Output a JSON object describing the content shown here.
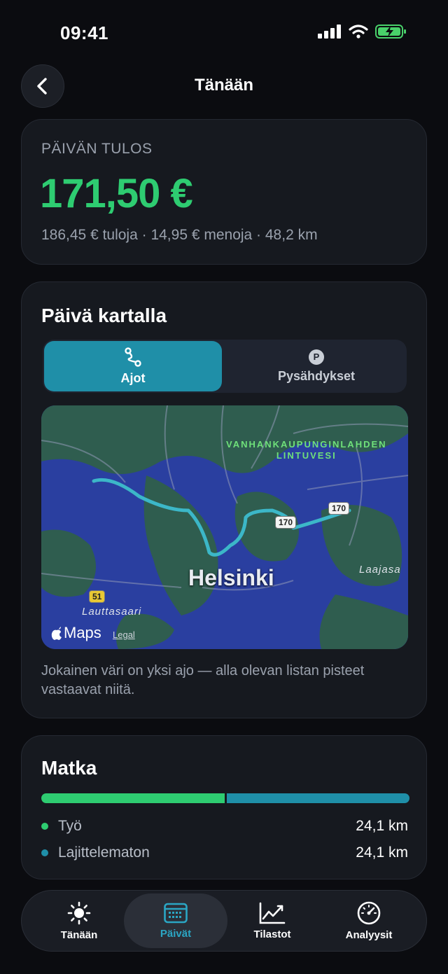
{
  "status_bar": {
    "time": "09:41"
  },
  "nav": {
    "title": "Tänään"
  },
  "summary": {
    "label": "PÄIVÄN TULOS",
    "amount": "171,50 €",
    "details": "186,45 € tuloja · 14,95 € menoja · 48,2 km"
  },
  "map_card": {
    "title": "Päivä kartalla",
    "segments": [
      {
        "label": "Ajot",
        "icon": "route-icon",
        "selected": true
      },
      {
        "label": "Pysähdykset",
        "icon": "parking-icon",
        "selected": false
      }
    ],
    "parking_badge": "P",
    "map": {
      "city_label": "Helsinki",
      "lake_label_line1": "VANHANKAUPUNGINLAHDEN",
      "lake_label_line2": "LINTUVESI",
      "district_label": "Lauttasaari",
      "east_label": "Laajasa",
      "road_shields": [
        "170",
        "170",
        "51"
      ],
      "maps_attribution": "Maps",
      "legal_link": "Legal"
    },
    "description": "Jokainen väri on yksi ajo — alla olevan listan pisteet vastaavat niitä."
  },
  "distance_card": {
    "title": "Matka",
    "bar": [
      {
        "name": "Työ",
        "km": 24.1,
        "color": "#2ecc71"
      },
      {
        "name": "Lajittelematon",
        "km": 24.1,
        "color": "#1f8fa8"
      }
    ],
    "rows": [
      {
        "label": "Työ",
        "value": "24,1 km",
        "color": "#2ecc71"
      },
      {
        "label": "Lajittelematon",
        "value": "24,1 km",
        "color": "#1f8fa8"
      }
    ]
  },
  "tab_bar": {
    "tabs": [
      {
        "label": "Tänään",
        "icon": "sun-icon"
      },
      {
        "label": "Päivät",
        "icon": "calendar-icon",
        "active": true
      },
      {
        "label": "Tilastot",
        "icon": "chart-icon"
      },
      {
        "label": "Analyysit",
        "icon": "gauge-icon"
      }
    ]
  },
  "colors": {
    "accent_green": "#2ecc71",
    "accent_teal": "#1f8fa8",
    "background": "#0b0c10"
  }
}
